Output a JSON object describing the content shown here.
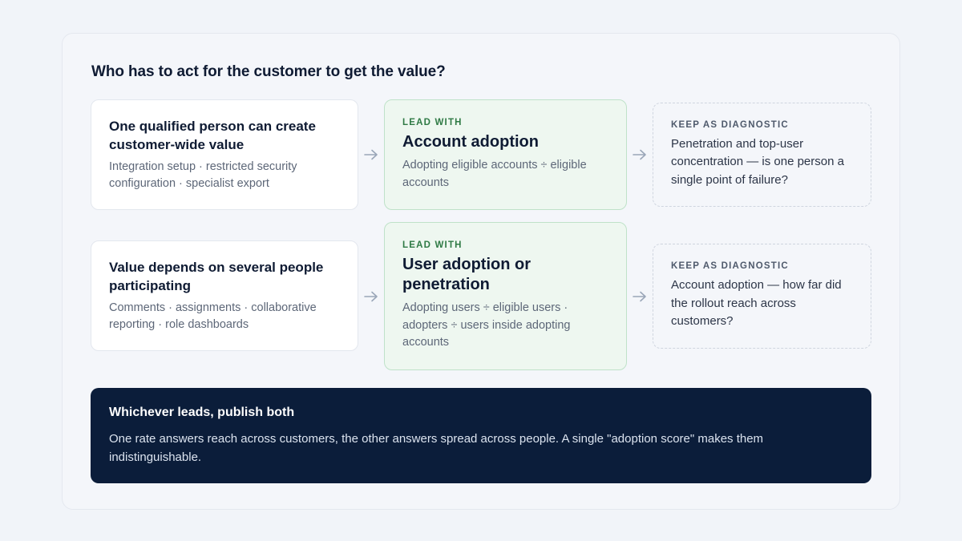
{
  "question": "Who has to act for the customer to get the value?",
  "rows": [
    {
      "scenario": {
        "title": "One qualified person can create customer-wide value",
        "examples": "Integration setup · restricted security configuration · specialist export"
      },
      "lead": {
        "eyebrow": "LEAD WITH",
        "metric": "Account adoption",
        "formula": "Adopting eligible accounts ÷ eligible accounts"
      },
      "diagnostic": {
        "eyebrow": "KEEP AS DIAGNOSTIC",
        "text": "Penetration and top-user concentration — is one person a single point of failure?"
      }
    },
    {
      "scenario": {
        "title": "Value depends on several people participating",
        "examples": "Comments · assignments · collaborative reporting · role dashboards"
      },
      "lead": {
        "eyebrow": "LEAD WITH",
        "metric": "User adoption or penetration",
        "formula": "Adopting users ÷ eligible users · adopters ÷ users inside adopting accounts"
      },
      "diagnostic": {
        "eyebrow": "KEEP AS DIAGNOSTIC",
        "text": "Account adoption — how far did the rollout reach across customers?"
      }
    }
  ],
  "banner": {
    "title": "Whichever leads, publish both",
    "body": "One rate answers reach across customers, the other answers spread across people. A single \"adoption score\" makes them indistinguishable."
  },
  "icons": {
    "arrow": "arrow-right-icon"
  },
  "colors": {
    "lead_background": "#eef7f0",
    "lead_border": "#bfe2c9",
    "lead_eyebrow": "#2f7a45",
    "banner_background": "#0b1d3a"
  }
}
